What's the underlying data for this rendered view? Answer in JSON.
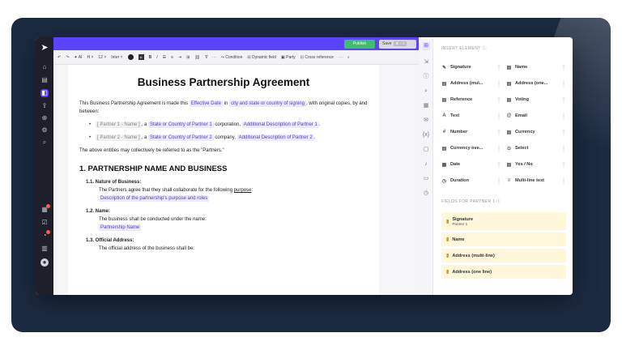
{
  "topbar": {
    "publish": "Publish",
    "save": "Save",
    "save_shortcut": "⌘ + S"
  },
  "toolbar": {
    "undo_icon": "undo-icon",
    "redo_icon": "redo-icon",
    "ai": "AI",
    "heading": "H",
    "font_size": "12",
    "font": "Inter",
    "bold": "B",
    "italic": "I",
    "underline": "U",
    "condition": "Condition",
    "dynamic_field": "Dynamic field",
    "party": "Party",
    "cross_reference": "Cross reference"
  },
  "document": {
    "title": "Business Partnership Agreement",
    "intro_1": "This Business Partnership Agreement is made this",
    "effective_date": "Effective Date",
    "intro_in": "in",
    "city_state": "city and state or country of signing",
    "intro_2": ", with original copies, by and between:",
    "party1_name": "[ Partner 1 - Name ]",
    "party1_a": ", a",
    "party1_state": "State or Country of Partner 1",
    "party1_corp": "corporation,",
    "party1_desc": "Additional Description of Partner 1",
    "party2_name": "[ Partner 2 - Name ]",
    "party2_a": ", a",
    "party2_state": "State or Country of Partner 2",
    "party2_corp": "company,",
    "party2_desc": "Additional Description of Partner 2",
    "entities": "The above entities may collectively be referred to as the \"Partners.\"",
    "section1": "1. PARTNERSHIP NAME AND BUSINESS",
    "s11_title": "1.1. Nature of Business:",
    "s11_text_a": "The Partners agree that they shall collaborate for the following",
    "s11_text_purpose": "purpose",
    "s11_field": "Description of the partnership's purpose and roles",
    "s12_title": "1.2. Name:",
    "s12_text": "The business shall be conducted under the name:",
    "s12_field": "Partnership Name",
    "s13_title": "1.3. Official Address:",
    "s13_text": "The official address of the business shall be:"
  },
  "panel": {
    "insert_heading": "INSERT ELEMENT",
    "elements": [
      {
        "icon": "signature-icon",
        "glyph": "✎",
        "label": "Signature"
      },
      {
        "icon": "name-icon",
        "glyph": "▤",
        "label": "Name"
      },
      {
        "icon": "address-multi-icon",
        "glyph": "▤",
        "label": "Address (mul..."
      },
      {
        "icon": "address-one-icon",
        "glyph": "▤",
        "label": "Address (one..."
      },
      {
        "icon": "reference-icon",
        "glyph": "▤",
        "label": "Reference"
      },
      {
        "icon": "voting-icon",
        "glyph": "▤",
        "label": "Voting"
      },
      {
        "icon": "text-icon",
        "glyph": "A",
        "label": "Text"
      },
      {
        "icon": "email-icon",
        "glyph": "@",
        "label": "Email"
      },
      {
        "icon": "number-icon",
        "glyph": "#",
        "label": "Number"
      },
      {
        "icon": "currency-icon",
        "glyph": "▤",
        "label": "Currency"
      },
      {
        "icon": "currency-over-icon",
        "glyph": "▤",
        "label": "Currency ove..."
      },
      {
        "icon": "select-icon",
        "glyph": "⊙",
        "label": "Select"
      },
      {
        "icon": "date-icon",
        "glyph": "▦",
        "label": "Date"
      },
      {
        "icon": "yes-no-icon",
        "glyph": "▤",
        "label": "Yes / No"
      },
      {
        "icon": "duration-icon",
        "glyph": "◷",
        "label": "Duration"
      },
      {
        "icon": "multiline-text-icon",
        "glyph": "≡",
        "label": "Multi-line text"
      }
    ],
    "partner_heading": "FIELDS FOR PARTNER 1",
    "partner_fields": [
      {
        "label": "Signature",
        "sub": "Partner 1"
      },
      {
        "label": "Name",
        "sub": ""
      },
      {
        "label": "Address (multi-line)",
        "sub": ""
      },
      {
        "label": "Address (one line)",
        "sub": ""
      }
    ]
  }
}
